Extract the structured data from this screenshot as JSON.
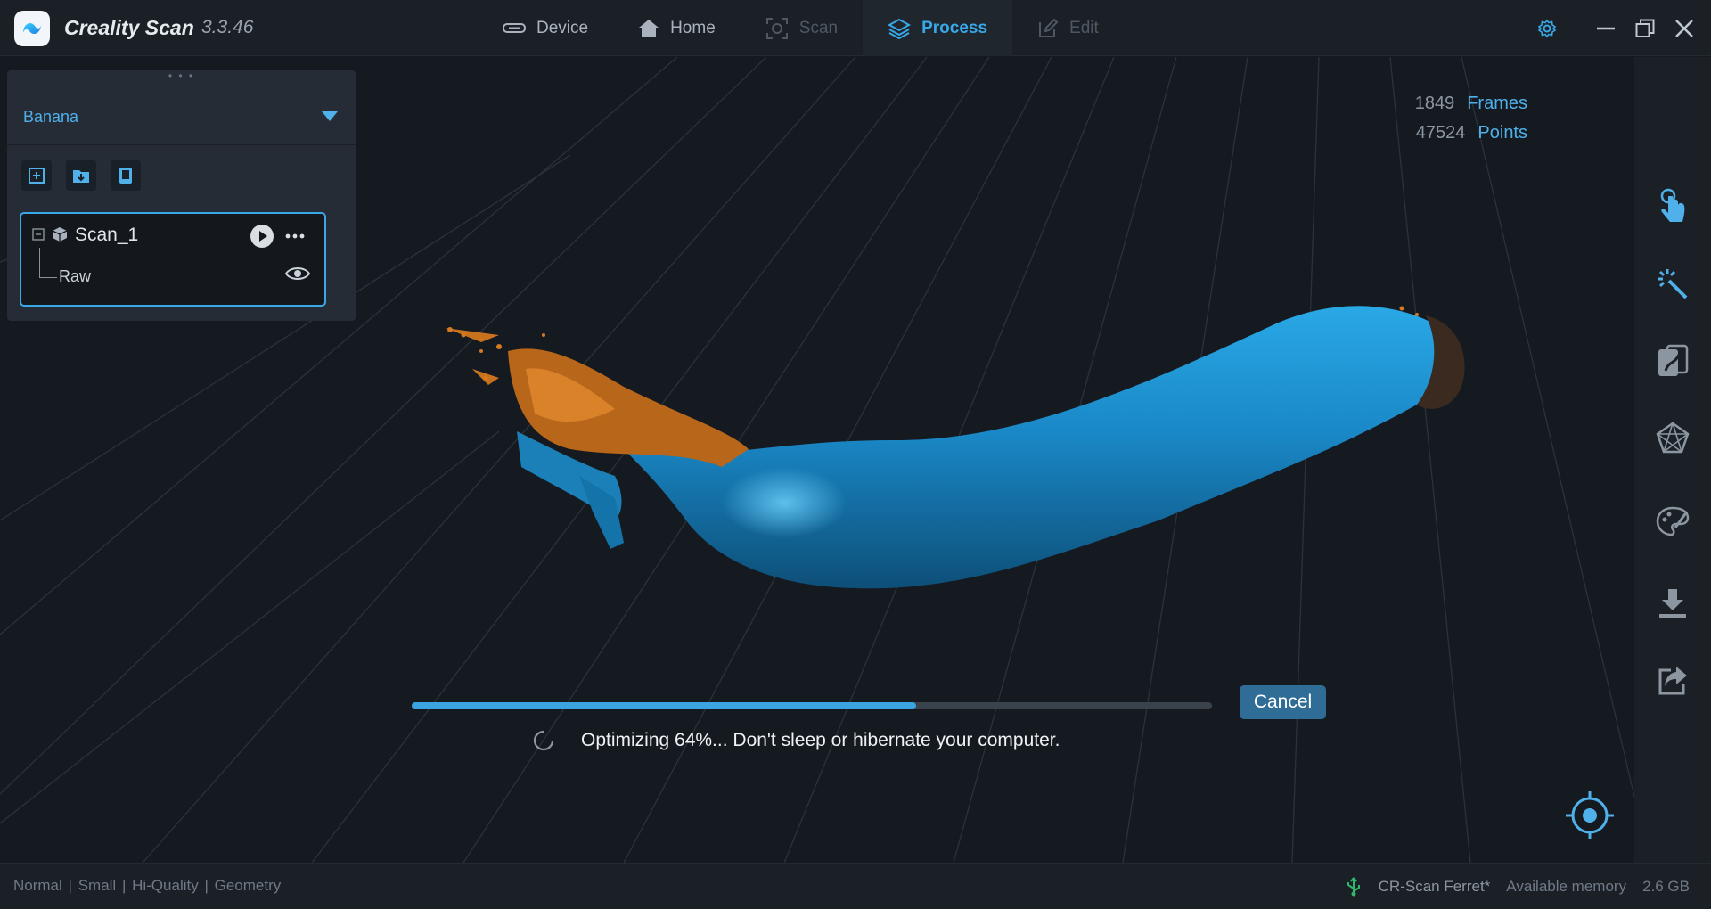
{
  "app": {
    "title": "Creality Scan",
    "version": "3.3.46"
  },
  "nav": {
    "tabs": [
      {
        "label": "Device",
        "icon": "device-icon",
        "state": "normal"
      },
      {
        "label": "Home",
        "icon": "home-icon",
        "state": "normal"
      },
      {
        "label": "Scan",
        "icon": "scan-icon",
        "state": "disabled"
      },
      {
        "label": "Process",
        "icon": "layers-icon",
        "state": "active"
      },
      {
        "label": "Edit",
        "icon": "edit-icon",
        "state": "disabled"
      }
    ]
  },
  "window_controls": [
    "settings-icon",
    "minimize-icon",
    "restore-icon",
    "close-icon"
  ],
  "panel": {
    "project": "Banana",
    "tools": [
      "add-project-icon",
      "import-folder-icon",
      "export-icon"
    ],
    "scan": {
      "name": "Scan_1",
      "child": "Raw"
    }
  },
  "stats": {
    "frames_value": "1849",
    "frames_label": "Frames",
    "points_value": "47524",
    "points_label": "Points"
  },
  "progress": {
    "fraction": 0.63,
    "cancel_label": "Cancel",
    "message": "Optimizing 64%... Don't sleep or hibernate your computer."
  },
  "right_toolbar": [
    "touch-select-icon",
    "magic-select-icon",
    "overlay-icon",
    "mesh-icon",
    "texture-icon",
    "download-icon",
    "share-icon"
  ],
  "footer": {
    "modes": [
      "Normal",
      "Small",
      "Hi-Quality",
      "Geometry"
    ],
    "separator": "|",
    "device": "CR-Scan Ferret*",
    "memory_label": "Available memory",
    "memory_value": "2.6 GB"
  },
  "colors": {
    "accent": "#38a8e8",
    "banana_blue": "#1f8fce",
    "stem_orange": "#c9721e"
  }
}
